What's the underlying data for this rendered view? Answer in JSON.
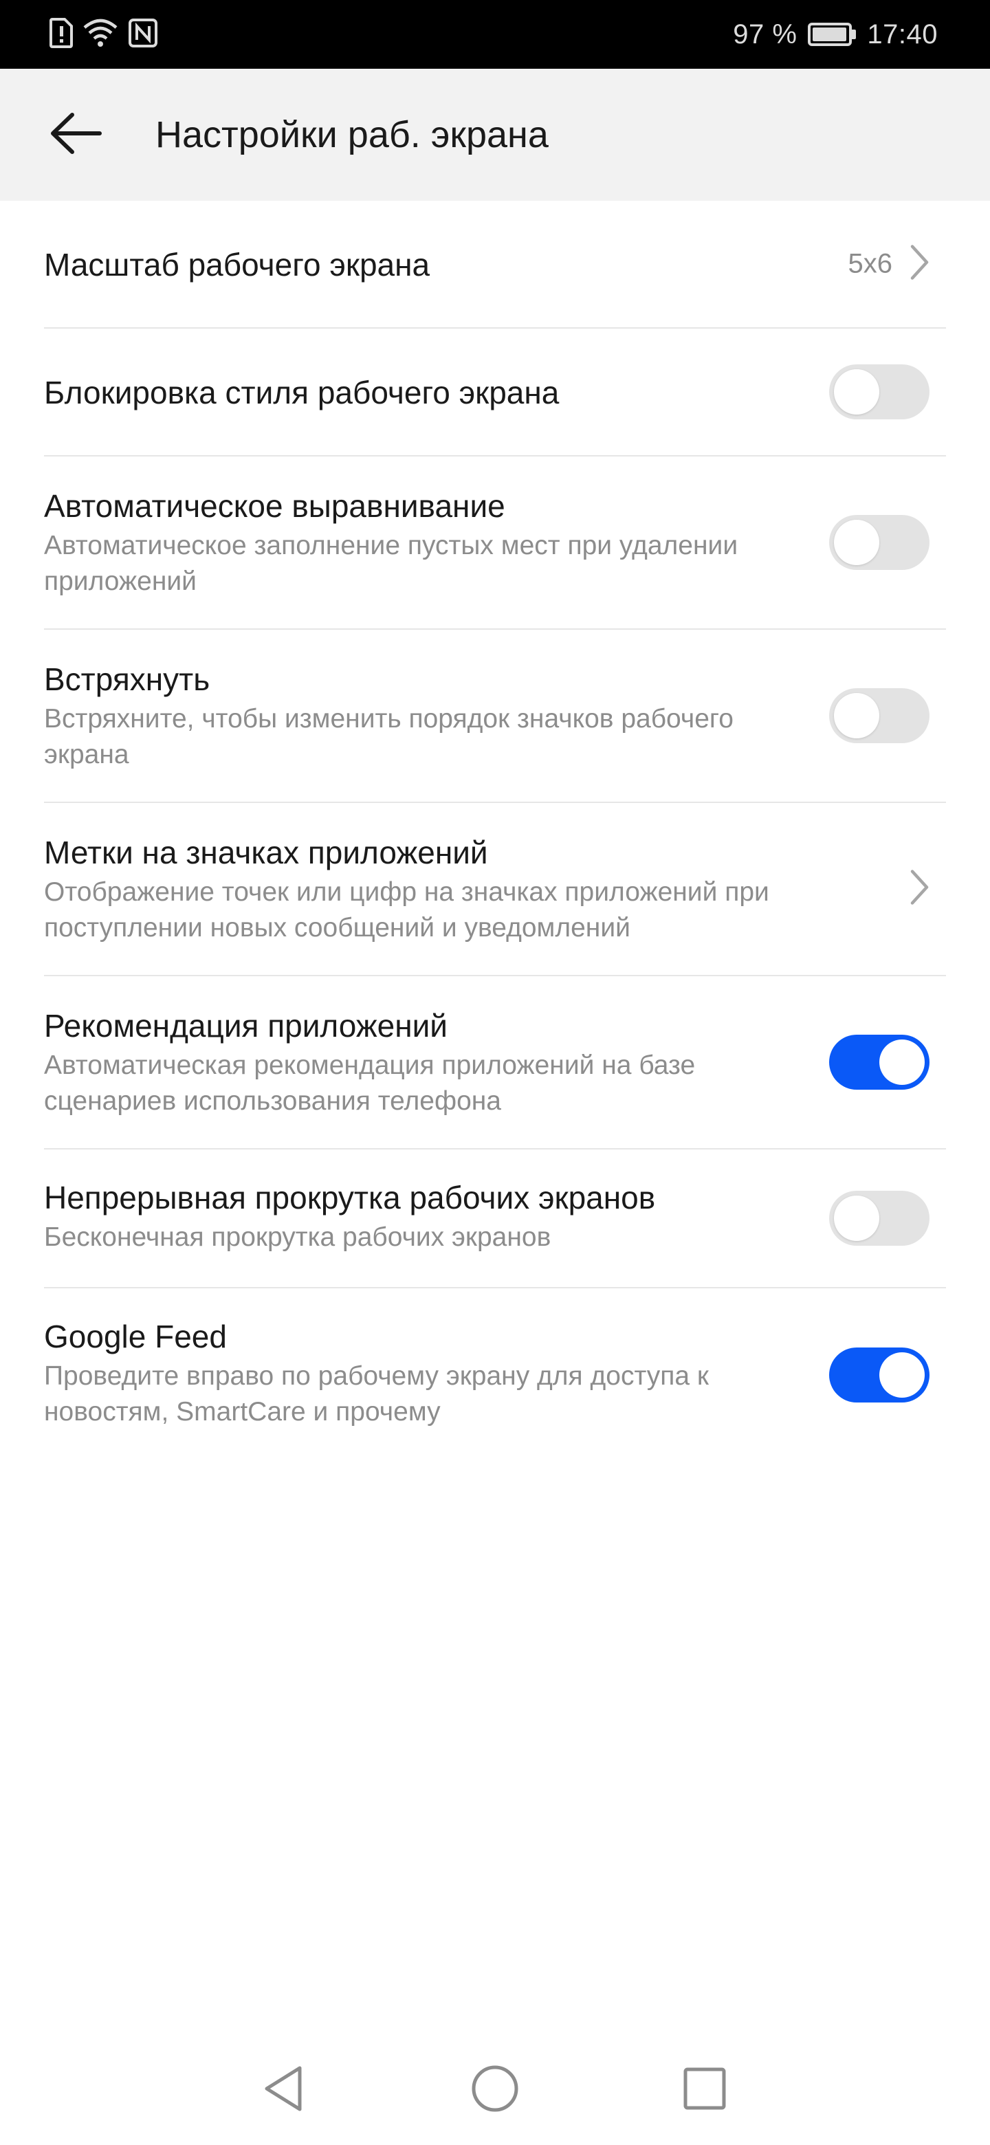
{
  "status_bar": {
    "battery_percent": "97 %",
    "battery_level": 0.97,
    "time": "17:40",
    "icons": [
      "sim-alert-icon",
      "wifi-icon",
      "nfc-icon",
      "battery-icon"
    ]
  },
  "header": {
    "title": "Настройки раб. экрана",
    "back_icon": "arrow-left-icon"
  },
  "colors": {
    "accent": "#0a59f7",
    "toggle_off": "#e3e3e3",
    "header_bg": "#f2f2f2"
  },
  "settings": [
    {
      "title": "Масштаб рабочего экрана",
      "value": "5x6",
      "control": "chevron"
    },
    {
      "title": "Блокировка стиля рабочего экрана",
      "control": "toggle",
      "on": false
    },
    {
      "title": "Автоматическое выравнивание",
      "subtitle": "Автоматическое заполнение пустых мест при удалении приложений",
      "control": "toggle",
      "on": false
    },
    {
      "title": "Встряхнуть",
      "subtitle": "Встряхните, чтобы изменить порядок значков рабочего экрана",
      "control": "toggle",
      "on": false
    },
    {
      "title": "Метки на значках приложений",
      "subtitle": "Отображение точек или цифр на значках приложений при поступлении новых сообщений и уведомлений",
      "control": "chevron"
    },
    {
      "title": "Рекомендация приложений",
      "subtitle": "Автоматическая рекомендация приложений на базе сценариев использования телефона",
      "control": "toggle",
      "on": true
    },
    {
      "title": "Непрерывная прокрутка рабочих экранов",
      "subtitle": "Бесконечная прокрутка рабочих экранов",
      "control": "toggle",
      "on": false
    },
    {
      "title": "Google Feed",
      "subtitle": "Проведите вправо по рабочему экрану для доступа к новостям, SmartCare и прочему",
      "control": "toggle",
      "on": true
    }
  ],
  "nav_bar": {
    "icons": [
      "back-triangle-icon",
      "home-circle-icon",
      "recents-square-icon"
    ]
  }
}
